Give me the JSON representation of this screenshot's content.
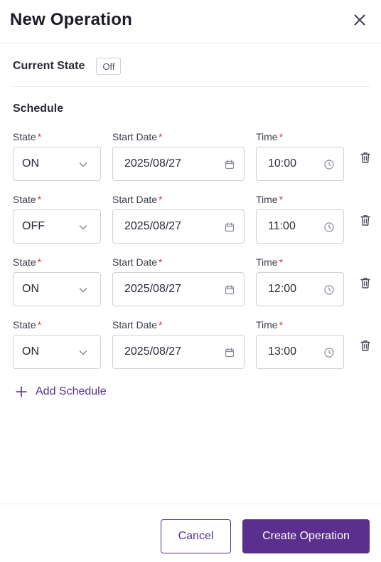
{
  "dialog": {
    "title": "New Operation"
  },
  "current_state": {
    "label": "Current State",
    "value": "Off"
  },
  "schedule": {
    "title": "Schedule",
    "labels": {
      "state": "State",
      "start_date": "Start Date",
      "time": "Time",
      "required_mark": "*"
    },
    "rows": [
      {
        "state": "ON",
        "start_date": "2025/08/27",
        "time": "10:00"
      },
      {
        "state": "OFF",
        "start_date": "2025/08/27",
        "time": "11:00"
      },
      {
        "state": "ON",
        "start_date": "2025/08/27",
        "time": "12:00"
      },
      {
        "state": "ON",
        "start_date": "2025/08/27",
        "time": "13:00"
      }
    ],
    "add_label": "Add Schedule"
  },
  "footer": {
    "cancel_label": "Cancel",
    "create_label": "Create Operation"
  },
  "colors": {
    "accent": "#5a2f8d",
    "required": "#d43a3a",
    "border": "#cfcfd8"
  },
  "icons": {
    "close": "close-icon",
    "state_select": "chevron-down-icon",
    "date": "calendar-icon",
    "time": "clock-icon",
    "delete": "trash-icon",
    "add": "plus-icon"
  }
}
